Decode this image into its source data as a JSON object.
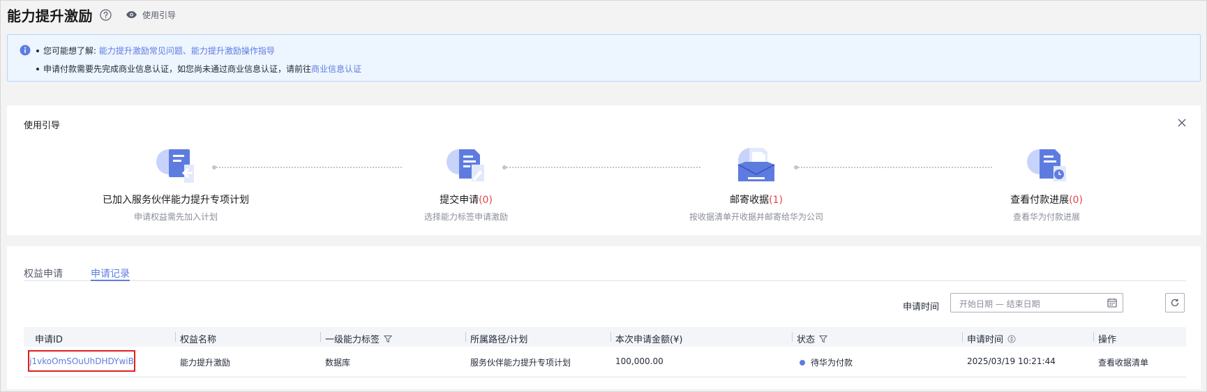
{
  "header": {
    "title": "能力提升激励",
    "guide_link": "使用引导"
  },
  "notice": {
    "line1_prefix": "您可能想了解:",
    "link_faq": "能力提升激励常见问题",
    "separator": "、",
    "link_guide": "能力提升激励操作指导",
    "line2_text": "申请付款需要先完成商业信息认证，如您尚未通过商业信息认证，请前往",
    "line2_link": "商业信息认证"
  },
  "guide": {
    "title": "使用引导",
    "steps": [
      {
        "name": "已加入服务伙伴能力提升专项计划",
        "count": "",
        "desc": "申请权益需先加入计划",
        "icon": "plan-joined-icon"
      },
      {
        "name": "提交申请",
        "count": "(0)",
        "desc": "选择能力标签申请激励",
        "icon": "submit-application-icon"
      },
      {
        "name": "邮寄收据",
        "count": "(1)",
        "desc": "按收据清单开收据并邮寄给华为公司",
        "icon": "mail-receipt-icon"
      },
      {
        "name": "查看付款进展",
        "count": "(0)",
        "desc": "查看华为付款进展",
        "icon": "payment-progress-icon"
      }
    ]
  },
  "tabs": [
    {
      "label": "权益申请",
      "active": false
    },
    {
      "label": "申请记录",
      "active": true
    }
  ],
  "filter": {
    "label": "申请时间",
    "date_placeholder": "开始日期 — 结束日期"
  },
  "table": {
    "columns": [
      "申请ID",
      "权益名称",
      "一级能力标签",
      "所属路径/计划",
      "本次申请金额(¥)",
      "状态",
      "申请时间",
      "操作"
    ],
    "rows": [
      {
        "id": "j1vkoOmSOuUhDHDYwiB",
        "benefit": "能力提升激励",
        "tag": "数据库",
        "path": "服务伙伴能力提升专项计划",
        "amount": "100,000.00",
        "status": "待华为付款",
        "time": "2025/03/19 10:21:44",
        "action": "查看收据清单"
      }
    ]
  },
  "colors": {
    "accent": "#5e7ce0",
    "highlight_border": "#e02020",
    "count_red": "#e54545"
  }
}
